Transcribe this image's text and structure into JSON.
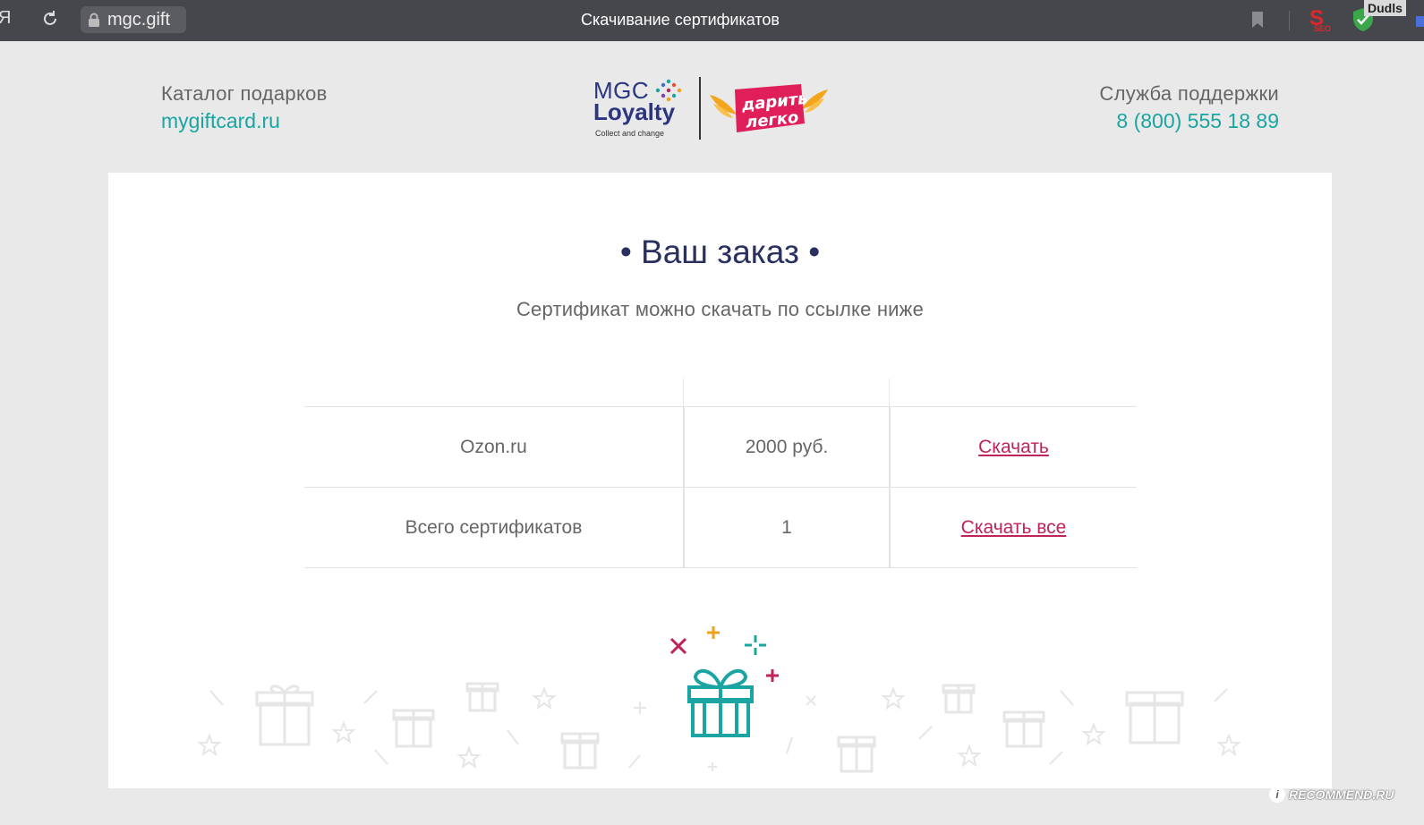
{
  "browser": {
    "url": "mgc.gift",
    "tab_title": "Скачивание сертификатов",
    "extension_label": "Dudls",
    "seo_label": "SEO"
  },
  "header": {
    "catalog_caption": "Каталог подарков",
    "catalog_link": "mygiftcard.ru",
    "support_caption": "Служба поддержки",
    "support_phone": "8 (800) 555 18 89",
    "logo": {
      "mgc": "MGC",
      "loyalty": "Loyalty",
      "tagline": "Collect and change",
      "partner_line1": "дарить",
      "partner_line2": "легко"
    }
  },
  "order": {
    "title": "• Ваш заказ •",
    "subtitle": "Сертификат можно скачать по ссылке ниже",
    "rows": [
      {
        "name": "Ozon.ru",
        "value": "2000 руб.",
        "action": "Скачать"
      },
      {
        "name": "Всего сертификатов",
        "value": "1",
        "action": "Скачать все"
      }
    ]
  },
  "watermark": "RECOMMEND.RU",
  "colors": {
    "accent_teal": "#1aa5a2",
    "link_red": "#c0225a",
    "title_navy": "#2a3160",
    "topbar": "#46474c"
  }
}
